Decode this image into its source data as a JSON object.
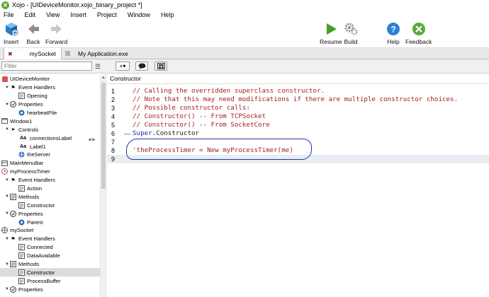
{
  "window": {
    "title": "Xojo - [UIDeviceMonitor.xojo_binary_project *]",
    "app_icon": "xojo-icon"
  },
  "menu": [
    "File",
    "Edit",
    "View",
    "Insert",
    "Project",
    "Window",
    "Help"
  ],
  "toolbar": {
    "insert_label": "Insert",
    "back_label": "Back",
    "forward_label": "Forward",
    "resume_label": "Resume",
    "build_label": "Build",
    "help_label": "Help",
    "feedback_label": "Feedback"
  },
  "tabs": [
    {
      "label": "mySocket",
      "active": true
    },
    {
      "label": "My Application.exe",
      "active": false
    }
  ],
  "navigator": {
    "filter_placeholder": "Filter",
    "items": [
      {
        "label": "UIDeviceMonitor",
        "icon": "app-icon"
      },
      {
        "label": "Event Handlers",
        "icon": "event-icon"
      },
      {
        "label": "Opening",
        "icon": "method-icon"
      },
      {
        "label": "Properties",
        "icon": "properties-icon"
      },
      {
        "label": "hearbeatFile",
        "icon": "property-icon"
      },
      {
        "label": "Window1",
        "icon": "window-icon"
      },
      {
        "label": "Controls",
        "icon": "controls-icon"
      },
      {
        "label": "connectionsLabel",
        "icon": "label-icon"
      },
      {
        "label": "Label1",
        "icon": "label-icon"
      },
      {
        "label": "theServer",
        "icon": "socket-icon"
      },
      {
        "label": "MainMenuBar",
        "icon": "menubar-icon"
      },
      {
        "label": "myProcessTimer",
        "icon": "timer-icon"
      },
      {
        "label": "Event Handlers",
        "icon": "event-icon"
      },
      {
        "label": "Action",
        "icon": "method-icon"
      },
      {
        "label": "Methods",
        "icon": "methods-icon"
      },
      {
        "label": "Constructor",
        "icon": "method-icon"
      },
      {
        "label": "Properties",
        "icon": "properties-icon"
      },
      {
        "label": "Parent",
        "icon": "property-icon"
      },
      {
        "label": "mySocket",
        "icon": "socket-icon"
      },
      {
        "label": "Event Handlers",
        "icon": "event-icon"
      },
      {
        "label": "Connected",
        "icon": "method-icon"
      },
      {
        "label": "DataAvailable",
        "icon": "method-icon"
      },
      {
        "label": "Methods",
        "icon": "methods-icon"
      },
      {
        "label": "Constructor",
        "icon": "method-icon"
      },
      {
        "label": "ProcessBuffer",
        "icon": "method-icon"
      },
      {
        "label": "Properties",
        "icon": "properties-icon"
      }
    ]
  },
  "editor": {
    "method_name": "Constructor",
    "lines": [
      {
        "num": "1",
        "text": "// Calling the overridden superclass constructor.",
        "kind": "comment"
      },
      {
        "num": "2",
        "text": "// Note that this may need modifications if there are multiple constructor choices.",
        "kind": "comment"
      },
      {
        "num": "3",
        "text": "// Possible constructor calls:",
        "kind": "comment"
      },
      {
        "num": "4",
        "text": "// Constructor() -- From TCPSocket",
        "kind": "comment"
      },
      {
        "num": "5",
        "text": "// Constructor() -- From SocketCore",
        "kind": "comment"
      },
      {
        "num": "6",
        "kw": "Super",
        "rest": ".Constructor",
        "kind": "code"
      },
      {
        "num": "7",
        "text": "",
        "kind": "blank"
      },
      {
        "num": "8",
        "text": "'theProcessTimer = New myProcessTimer(me)",
        "kind": "comment"
      },
      {
        "num": "9",
        "text": "",
        "kind": "blank"
      }
    ]
  },
  "colors": {
    "accent_green": "#3f9f2a",
    "comment": "#a32020",
    "keyword": "#2020c8",
    "annotation_circle": "#1e36a0"
  }
}
